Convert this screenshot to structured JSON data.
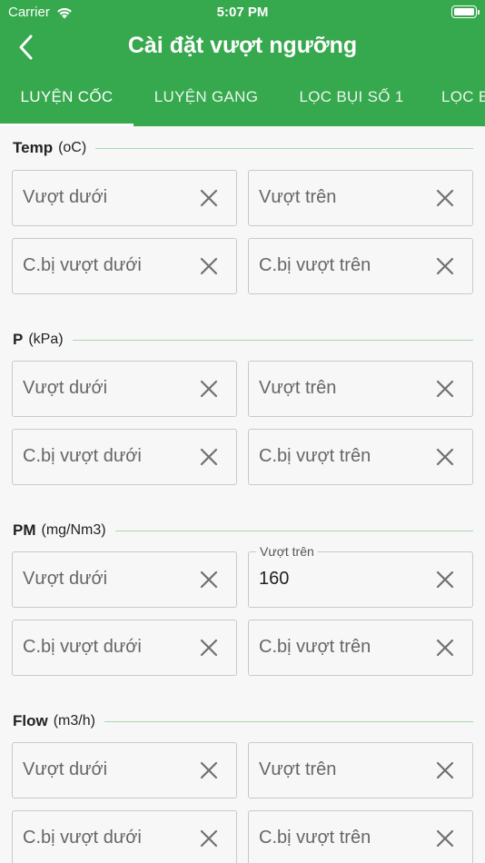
{
  "status_bar": {
    "carrier": "Carrier",
    "time": "5:07 PM"
  },
  "header": {
    "title": "Cài đặt vượt ngưỡng"
  },
  "tabs": [
    {
      "label": "LUYỆN CỐC",
      "active": true
    },
    {
      "label": "LUYỆN GANG",
      "active": false
    },
    {
      "label": "LỌC BỤI SỐ 1",
      "active": false
    },
    {
      "label": "LỌC B",
      "active": false
    }
  ],
  "colors": {
    "primary": "#36a84d",
    "divider": "#a8d7ad"
  },
  "sections": [
    {
      "name": "Temp",
      "unit": "(oC)",
      "fields": [
        {
          "placeholder": "Vượt dưới",
          "value": ""
        },
        {
          "placeholder": "Vượt trên",
          "value": ""
        },
        {
          "placeholder": "C.bị vượt dưới",
          "value": ""
        },
        {
          "placeholder": "C.bị vượt trên",
          "value": ""
        }
      ]
    },
    {
      "name": "P",
      "unit": "(kPa)",
      "fields": [
        {
          "placeholder": "Vượt dưới",
          "value": ""
        },
        {
          "placeholder": "Vượt trên",
          "value": ""
        },
        {
          "placeholder": "C.bị vượt dưới",
          "value": ""
        },
        {
          "placeholder": "C.bị vượt trên",
          "value": ""
        }
      ]
    },
    {
      "name": "PM",
      "unit": "(mg/Nm3)",
      "fields": [
        {
          "placeholder": "Vượt dưới",
          "value": ""
        },
        {
          "placeholder": "Vượt trên",
          "value": "160"
        },
        {
          "placeholder": "C.bị vượt dưới",
          "value": ""
        },
        {
          "placeholder": "C.bị vượt trên",
          "value": ""
        }
      ]
    },
    {
      "name": "Flow",
      "unit": "(m3/h)",
      "fields": [
        {
          "placeholder": "Vượt dưới",
          "value": ""
        },
        {
          "placeholder": "Vượt trên",
          "value": ""
        },
        {
          "placeholder": "C.bị vượt dưới",
          "value": ""
        },
        {
          "placeholder": "C.bị vượt trên",
          "value": ""
        }
      ]
    }
  ]
}
